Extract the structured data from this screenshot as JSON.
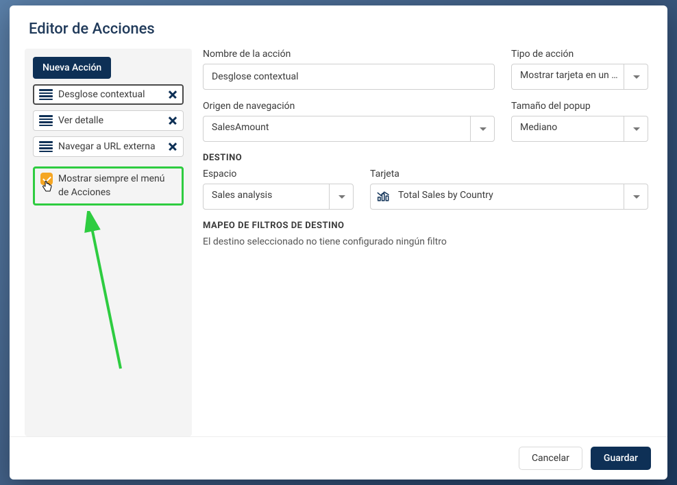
{
  "title": "Editor de Acciones",
  "sidebar": {
    "new_action_label": "Nueva Acción",
    "actions": [
      {
        "label": "Desglose contextual"
      },
      {
        "label": "Ver detalle"
      },
      {
        "label": "Navegar a URL externa"
      }
    ],
    "always_show_label": "Mostrar siempre el menú de Acciones"
  },
  "form": {
    "action_name_label": "Nombre de la acción",
    "action_name_value": "Desglose contextual",
    "action_type_label": "Tipo de acción",
    "action_type_value": "Mostrar tarjeta en un …",
    "nav_origin_label": "Origen de navegación",
    "nav_origin_value": "SalesAmount",
    "popup_size_label": "Tamaño del popup",
    "popup_size_value": "Mediano",
    "destination_heading": "DESTINO",
    "space_label": "Espacio",
    "space_value": "Sales analysis",
    "card_label": "Tarjeta",
    "card_value": "Total Sales by Country",
    "filter_mapping_heading": "MAPEO DE FILTROS DE DESTINO",
    "filter_mapping_info": "El destino seleccionado no tiene configurado ningún filtro"
  },
  "footer": {
    "cancel_label": "Cancelar",
    "save_label": "Guardar"
  }
}
